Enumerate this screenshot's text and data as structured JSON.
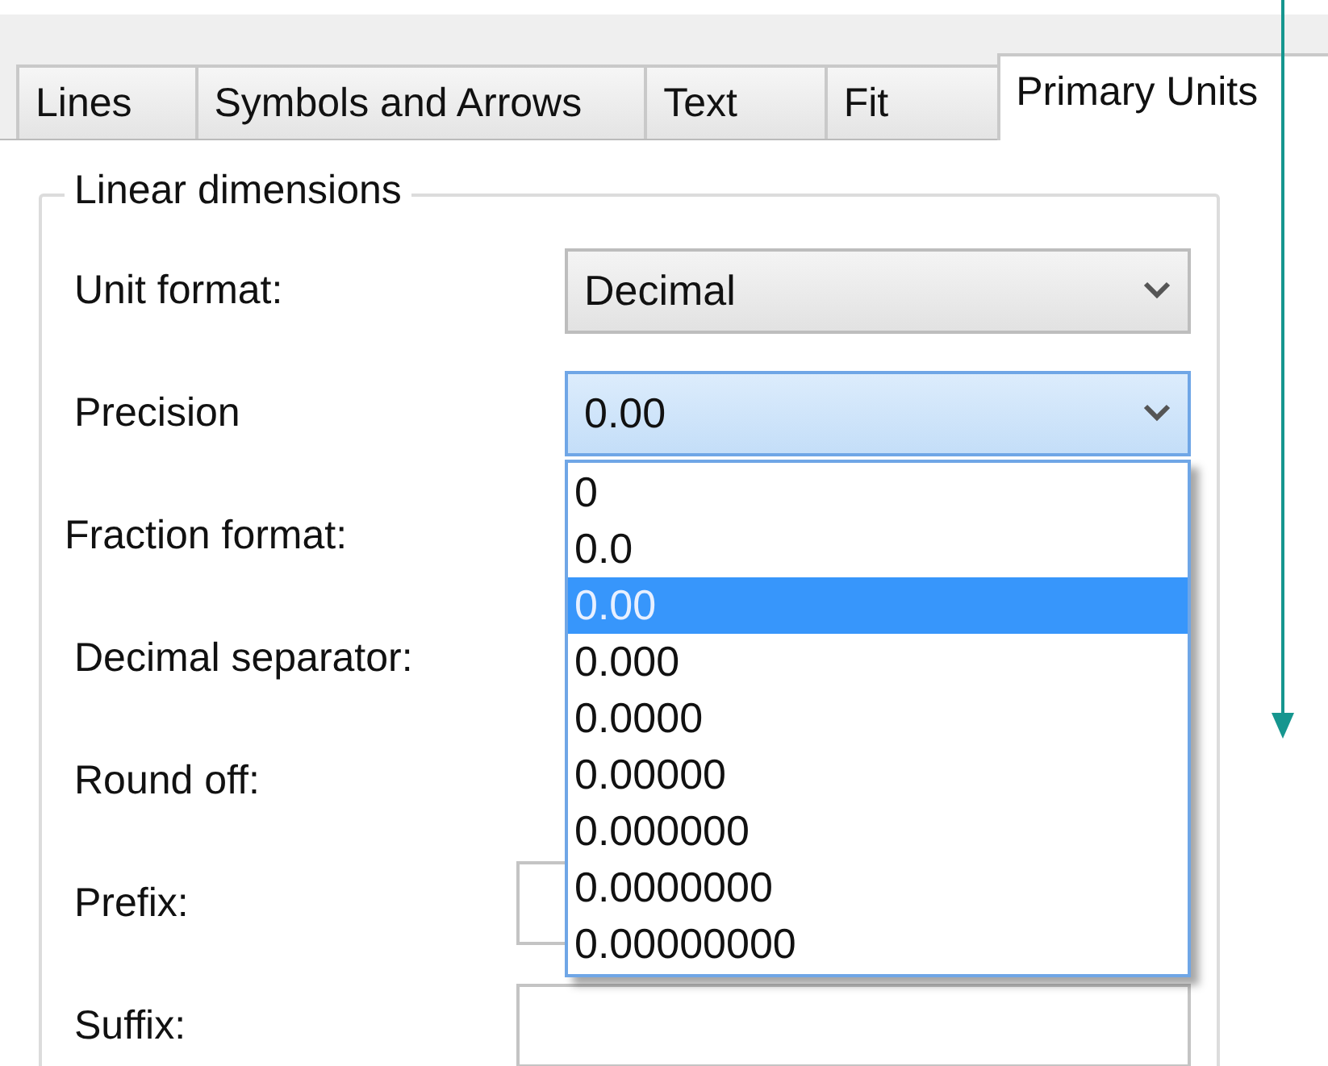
{
  "tabs": [
    {
      "label": "Lines",
      "selected": false
    },
    {
      "label": "Symbols and Arrows",
      "selected": false
    },
    {
      "label": "Text",
      "selected": false
    },
    {
      "label": "Fit",
      "selected": false
    },
    {
      "label": "Primary Units",
      "selected": true
    }
  ],
  "group": {
    "title": "Linear dimensions",
    "fields": [
      {
        "label": "Unit format:",
        "kind": "combo",
        "value": "Decimal",
        "focused": false
      },
      {
        "label": "Precision",
        "kind": "combo",
        "value": "0.00",
        "focused": true,
        "expanded": true,
        "options": [
          {
            "label": "0",
            "selected": false
          },
          {
            "label": "0.0",
            "selected": false
          },
          {
            "label": "0.00",
            "selected": true
          },
          {
            "label": "0.000",
            "selected": false
          },
          {
            "label": "0.0000",
            "selected": false
          },
          {
            "label": "0.00000",
            "selected": false
          },
          {
            "label": "0.000000",
            "selected": false
          },
          {
            "label": "0.0000000",
            "selected": false
          },
          {
            "label": "0.00000000",
            "selected": false
          }
        ]
      },
      {
        "label": "Fraction format:",
        "kind": "label"
      },
      {
        "label": "Decimal separator:",
        "kind": "label"
      },
      {
        "label": "Round off:",
        "kind": "label"
      },
      {
        "label": "Prefix:",
        "kind": "text"
      },
      {
        "label": "Suffix:",
        "kind": "text"
      }
    ]
  }
}
